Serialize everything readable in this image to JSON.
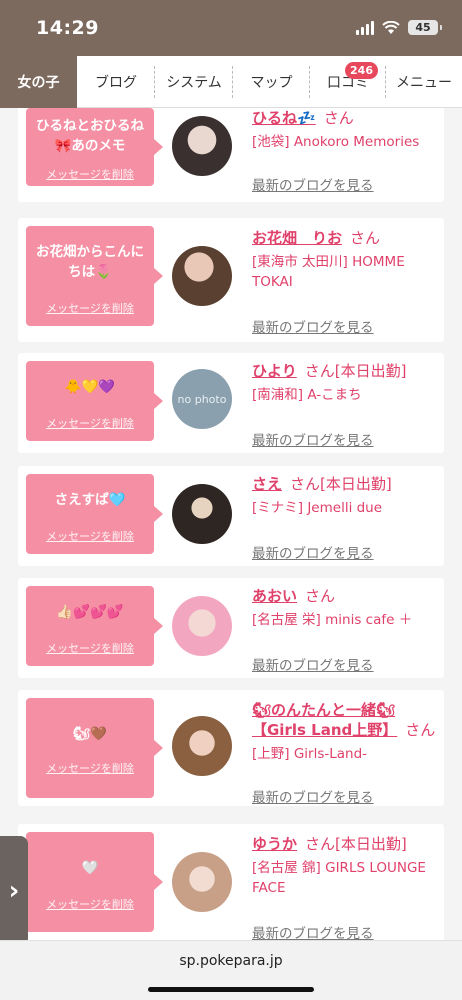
{
  "status": {
    "time": "14:29",
    "battery": "45"
  },
  "nav": {
    "tabs": [
      {
        "label": "女の子"
      },
      {
        "label": "ブログ"
      },
      {
        "label": "システム"
      },
      {
        "label": "マップ"
      },
      {
        "label": "口コミ",
        "badge": "246"
      },
      {
        "label": "メニュー"
      }
    ]
  },
  "common": {
    "delete_label": "メッセージを削除",
    "blog_label": "最新のブログを見る",
    "san": "さん"
  },
  "items": [
    {
      "message": "ひるねとおひるね🎀あのメモ",
      "name": "ひるね💤",
      "suffix": "",
      "shop": "[池袋] Anokoro Memories"
    },
    {
      "message": "お花畑からこんにちは🌷",
      "name": "お花畑　りお",
      "suffix": "",
      "shop": "[東海市 太田川] HOMME TOKAI"
    },
    {
      "message": "🐥💛💜",
      "name": "ひより",
      "suffix": "[本日出勤]",
      "shop": "[南浦和] A-こまち",
      "avatar_text": "no photo"
    },
    {
      "message": "さえすぱ🩵",
      "name": "さえ",
      "suffix": "[本日出勤]",
      "shop": "[ミナミ] Jemelli due"
    },
    {
      "message": "👍🏻💕💕💕",
      "name": "あおい",
      "suffix": "",
      "shop": "[名古屋 栄] minis cafe ＋"
    },
    {
      "message": "🐿🤎",
      "name": "🐿のんたんと一緒🐿【Girls Land上野】",
      "suffix": "",
      "shop": "[上野] Girls-Land-"
    },
    {
      "message": "🤍",
      "name": "ゆうか",
      "suffix": "[本日出勤]",
      "shop": "[名古屋 錦] GIRLS LOUNGE FACE"
    }
  ],
  "url": "sp.pokepara.jp",
  "colors": {
    "accent": "#e0416a",
    "bubble": "#f590a4",
    "nav_active": "#7c6a5e"
  }
}
